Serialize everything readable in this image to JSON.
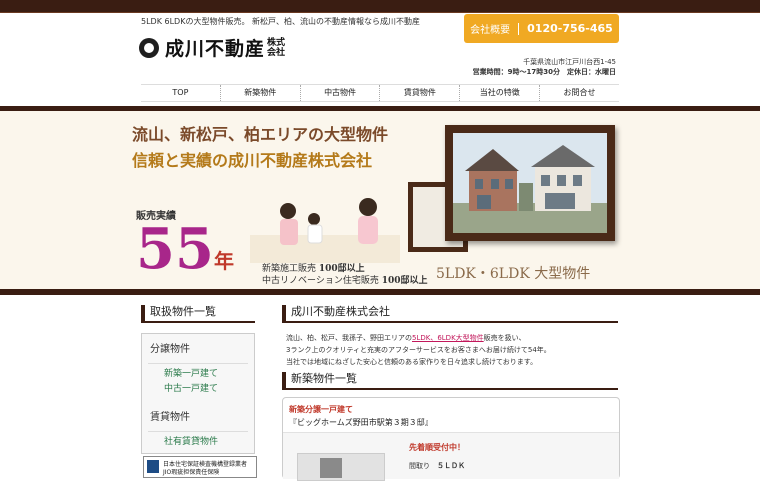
{
  "header": {
    "tagline": "5LDK 6LDKの大型物件販売。 新松戸、柏、流山の不動産情報なら成川不動産",
    "logo_text": "成川不動産",
    "logo_suffix_1": "株式",
    "logo_suffix_2": "会社",
    "contact_label": "会社概要",
    "phone": "0120-756-465",
    "address": "千葉県流山市江戸川台西1-45",
    "hours": "営業時間：9時〜17時30分　定休日：水曜日"
  },
  "nav": {
    "items": [
      "TOP",
      "新築物件",
      "中古物件",
      "賃貸物件",
      "当社の特徴",
      "お問合せ"
    ]
  },
  "hero": {
    "line1": "流山、新松戸、柏エリアの大型物件",
    "line2": "信頼と実績の成川不動産株式会社",
    "badge": "販売実績",
    "years": "55",
    "years_unit": "年",
    "stat1_label": "新築施工販売 ",
    "stat1_value": "100邸以上",
    "stat2_label": "中古リノベーション住宅販売 ",
    "stat2_value": "100邸以上",
    "plan": "5LDK・6LDK 大型物件"
  },
  "sidebar": {
    "title": "取扱物件一覧",
    "groups": [
      {
        "heading": "分譲物件",
        "links": [
          "新築一戸建て",
          "中古一戸建て"
        ]
      },
      {
        "heading": "賃貸物件",
        "links": [
          "社有賃貸物件"
        ]
      }
    ],
    "banner_line1": "日本住宅保証検査機構登録業者",
    "banner_line2": "JIO瑕疵担保責任保険"
  },
  "main": {
    "company_title": "成川不動産株式会社",
    "intro_pre": "流山、柏、松戸、我孫子、野田エリアの",
    "intro_highlight": "5LDK、6LDK大型物件",
    "intro_post": "販売を扱い、",
    "intro_line2": "3ランク上のクオリティと充実のアフターサービスをお客さまへお届け続けて54年。",
    "intro_line3": "当社では地域にねざした安心と信頼のある家作りを日々追求し続けております。",
    "new_title": "新築物件一覧",
    "card": {
      "tag": "新築分譲一戸建て",
      "name": "『ビッグホームズ野田市駅第３期３邸』",
      "status": "先着順受付中！",
      "layout_label": "間取り",
      "layout_value": "５ＬＤＫ"
    }
  },
  "colors": {
    "dark_brown": "#3a1d12",
    "accent_orange": "#f0a923",
    "magenta": "#a8268a",
    "link_green": "#2a7a4a"
  }
}
